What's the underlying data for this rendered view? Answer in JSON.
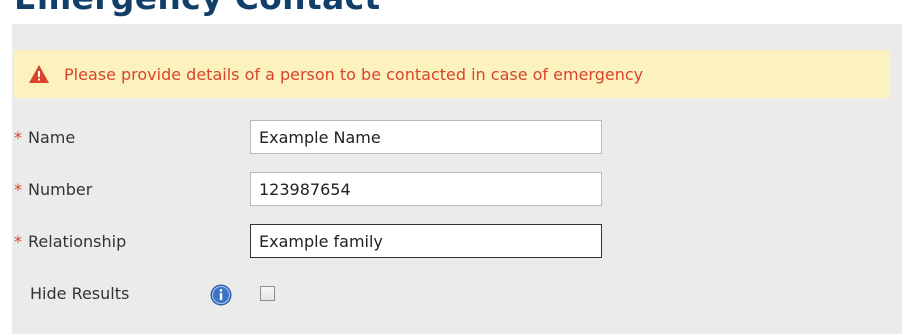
{
  "header": {
    "title": "Emergency Contact"
  },
  "alert": {
    "icon": "warning-icon",
    "message": "Please provide details of a person to be contacted in case of emergency",
    "text_color": "#d9442a",
    "background": "#fbf2bd"
  },
  "form": {
    "required_marker": "*",
    "name": {
      "label": "Name",
      "value": "Example Name"
    },
    "number": {
      "label": "Number",
      "value": "123987654"
    },
    "relationship": {
      "label": "Relationship",
      "value": "Example family"
    },
    "hide_results": {
      "label": "Hide Results",
      "checked": false,
      "info_icon": "info-icon"
    }
  },
  "colors": {
    "panel_background": "#ebebeb",
    "header_text": "#123f6a",
    "info_icon": "#3b73c7"
  }
}
